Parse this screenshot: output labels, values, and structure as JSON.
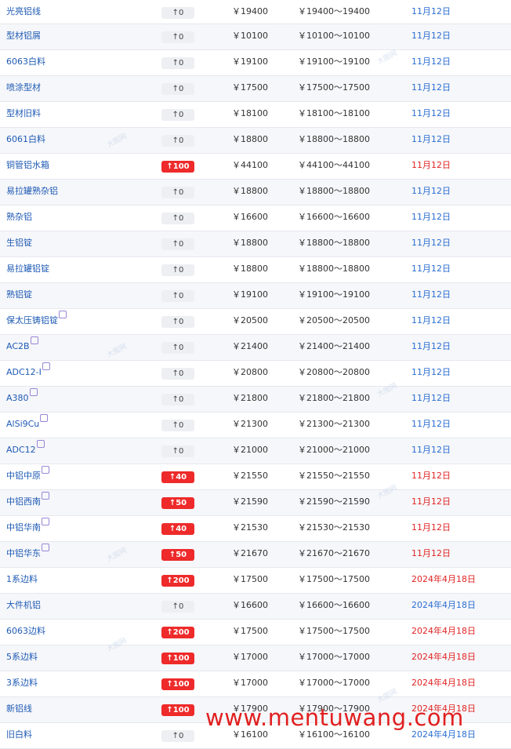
{
  "rows": [
    {
      "name": "光亮铝线",
      "change": "↑0",
      "price": "￥19400",
      "range": "￥19400～19400",
      "date": "11月12日",
      "up": false,
      "mark": false
    },
    {
      "name": "型材铝屑",
      "change": "↑0",
      "price": "￥10100",
      "range": "￥10100～10100",
      "date": "11月12日",
      "up": false,
      "mark": false
    },
    {
      "name": "6063白料",
      "change": "↑0",
      "price": "￥19100",
      "range": "￥19100～19100",
      "date": "11月12日",
      "up": false,
      "mark": false
    },
    {
      "name": "喷涂型材",
      "change": "↑0",
      "price": "￥17500",
      "range": "￥17500～17500",
      "date": "11月12日",
      "up": false,
      "mark": false
    },
    {
      "name": "型材旧料",
      "change": "↑0",
      "price": "￥18100",
      "range": "￥18100～18100",
      "date": "11月12日",
      "up": false,
      "mark": false
    },
    {
      "name": "6061白料",
      "change": "↑0",
      "price": "￥18800",
      "range": "￥18800～18800",
      "date": "11月12日",
      "up": false,
      "mark": false
    },
    {
      "name": "铜管铝水箱",
      "change": "↑100",
      "price": "￥44100",
      "range": "￥44100～44100",
      "date": "11月12日",
      "up": true,
      "mark": false
    },
    {
      "name": "易拉罐熟杂铝",
      "change": "↑0",
      "price": "￥18800",
      "range": "￥18800～18800",
      "date": "11月12日",
      "up": false,
      "mark": false
    },
    {
      "name": "熟杂铝",
      "change": "↑0",
      "price": "￥16600",
      "range": "￥16600～16600",
      "date": "11月12日",
      "up": false,
      "mark": false
    },
    {
      "name": "生铝锭",
      "change": "↑0",
      "price": "￥18800",
      "range": "￥18800～18800",
      "date": "11月12日",
      "up": false,
      "mark": false
    },
    {
      "name": "易拉罐铝锭",
      "change": "↑0",
      "price": "￥18800",
      "range": "￥18800～18800",
      "date": "11月12日",
      "up": false,
      "mark": false
    },
    {
      "name": "熟铝锭",
      "change": "↑0",
      "price": "￥19100",
      "range": "￥19100～19100",
      "date": "11月12日",
      "up": false,
      "mark": false
    },
    {
      "name": "保太压铸铝锭",
      "change": "↑0",
      "price": "￥20500",
      "range": "￥20500～20500",
      "date": "11月12日",
      "up": false,
      "mark": true
    },
    {
      "name": "AC2B",
      "change": "↑0",
      "price": "￥21400",
      "range": "￥21400～21400",
      "date": "11月12日",
      "up": false,
      "mark": true
    },
    {
      "name": "ADC12-I",
      "change": "↑0",
      "price": "￥20800",
      "range": "￥20800～20800",
      "date": "11月12日",
      "up": false,
      "mark": true
    },
    {
      "name": "A380",
      "change": "↑0",
      "price": "￥21800",
      "range": "￥21800～21800",
      "date": "11月12日",
      "up": false,
      "mark": true
    },
    {
      "name": "AlSi9Cu",
      "change": "↑0",
      "price": "￥21300",
      "range": "￥21300～21300",
      "date": "11月12日",
      "up": false,
      "mark": true
    },
    {
      "name": "ADC12",
      "change": "↑0",
      "price": "￥21000",
      "range": "￥21000～21000",
      "date": "11月12日",
      "up": false,
      "mark": true
    },
    {
      "name": "中铝中原",
      "change": "↑40",
      "price": "￥21550",
      "range": "￥21550～21550",
      "date": "11月12日",
      "up": true,
      "mark": true
    },
    {
      "name": "中铝西南",
      "change": "↑50",
      "price": "￥21590",
      "range": "￥21590～21590",
      "date": "11月12日",
      "up": true,
      "mark": true
    },
    {
      "name": "中铝华南",
      "change": "↑40",
      "price": "￥21530",
      "range": "￥21530～21530",
      "date": "11月12日",
      "up": true,
      "mark": true
    },
    {
      "name": "中铝华东",
      "change": "↑50",
      "price": "￥21670",
      "range": "￥21670～21670",
      "date": "11月12日",
      "up": true,
      "mark": true
    },
    {
      "name": "1系边料",
      "change": "↑200",
      "price": "￥17500",
      "range": "￥17500～17500",
      "date": "2024年4月18日",
      "up": true,
      "mark": false
    },
    {
      "name": "大件机铝",
      "change": "↑0",
      "price": "￥16600",
      "range": "￥16600～16600",
      "date": "2024年4月18日",
      "up": false,
      "mark": false
    },
    {
      "name": "6063边料",
      "change": "↑200",
      "price": "￥17500",
      "range": "￥17500～17500",
      "date": "2024年4月18日",
      "up": true,
      "mark": false
    },
    {
      "name": "5系边料",
      "change": "↑100",
      "price": "￥17000",
      "range": "￥17000～17000",
      "date": "2024年4月18日",
      "up": true,
      "mark": false
    },
    {
      "name": "3系边料",
      "change": "↑100",
      "price": "￥17000",
      "range": "￥17000～17000",
      "date": "2024年4月18日",
      "up": true,
      "mark": false
    },
    {
      "name": "新铝线",
      "change": "↑100",
      "price": "￥17900",
      "range": "￥17900～17900",
      "date": "2024年4月18日",
      "up": true,
      "mark": false
    },
    {
      "name": "旧白料",
      "change": "↑0",
      "price": "￥16100",
      "range": "￥16100～16100",
      "date": "2024年4月18日",
      "up": false,
      "mark": false
    }
  ],
  "watermark": "大图网",
  "footer": "www.mentuwang.com",
  "colors": {
    "up": "#ee2a2a",
    "link": "#1e5ab4",
    "date": "#2a6ed1"
  }
}
